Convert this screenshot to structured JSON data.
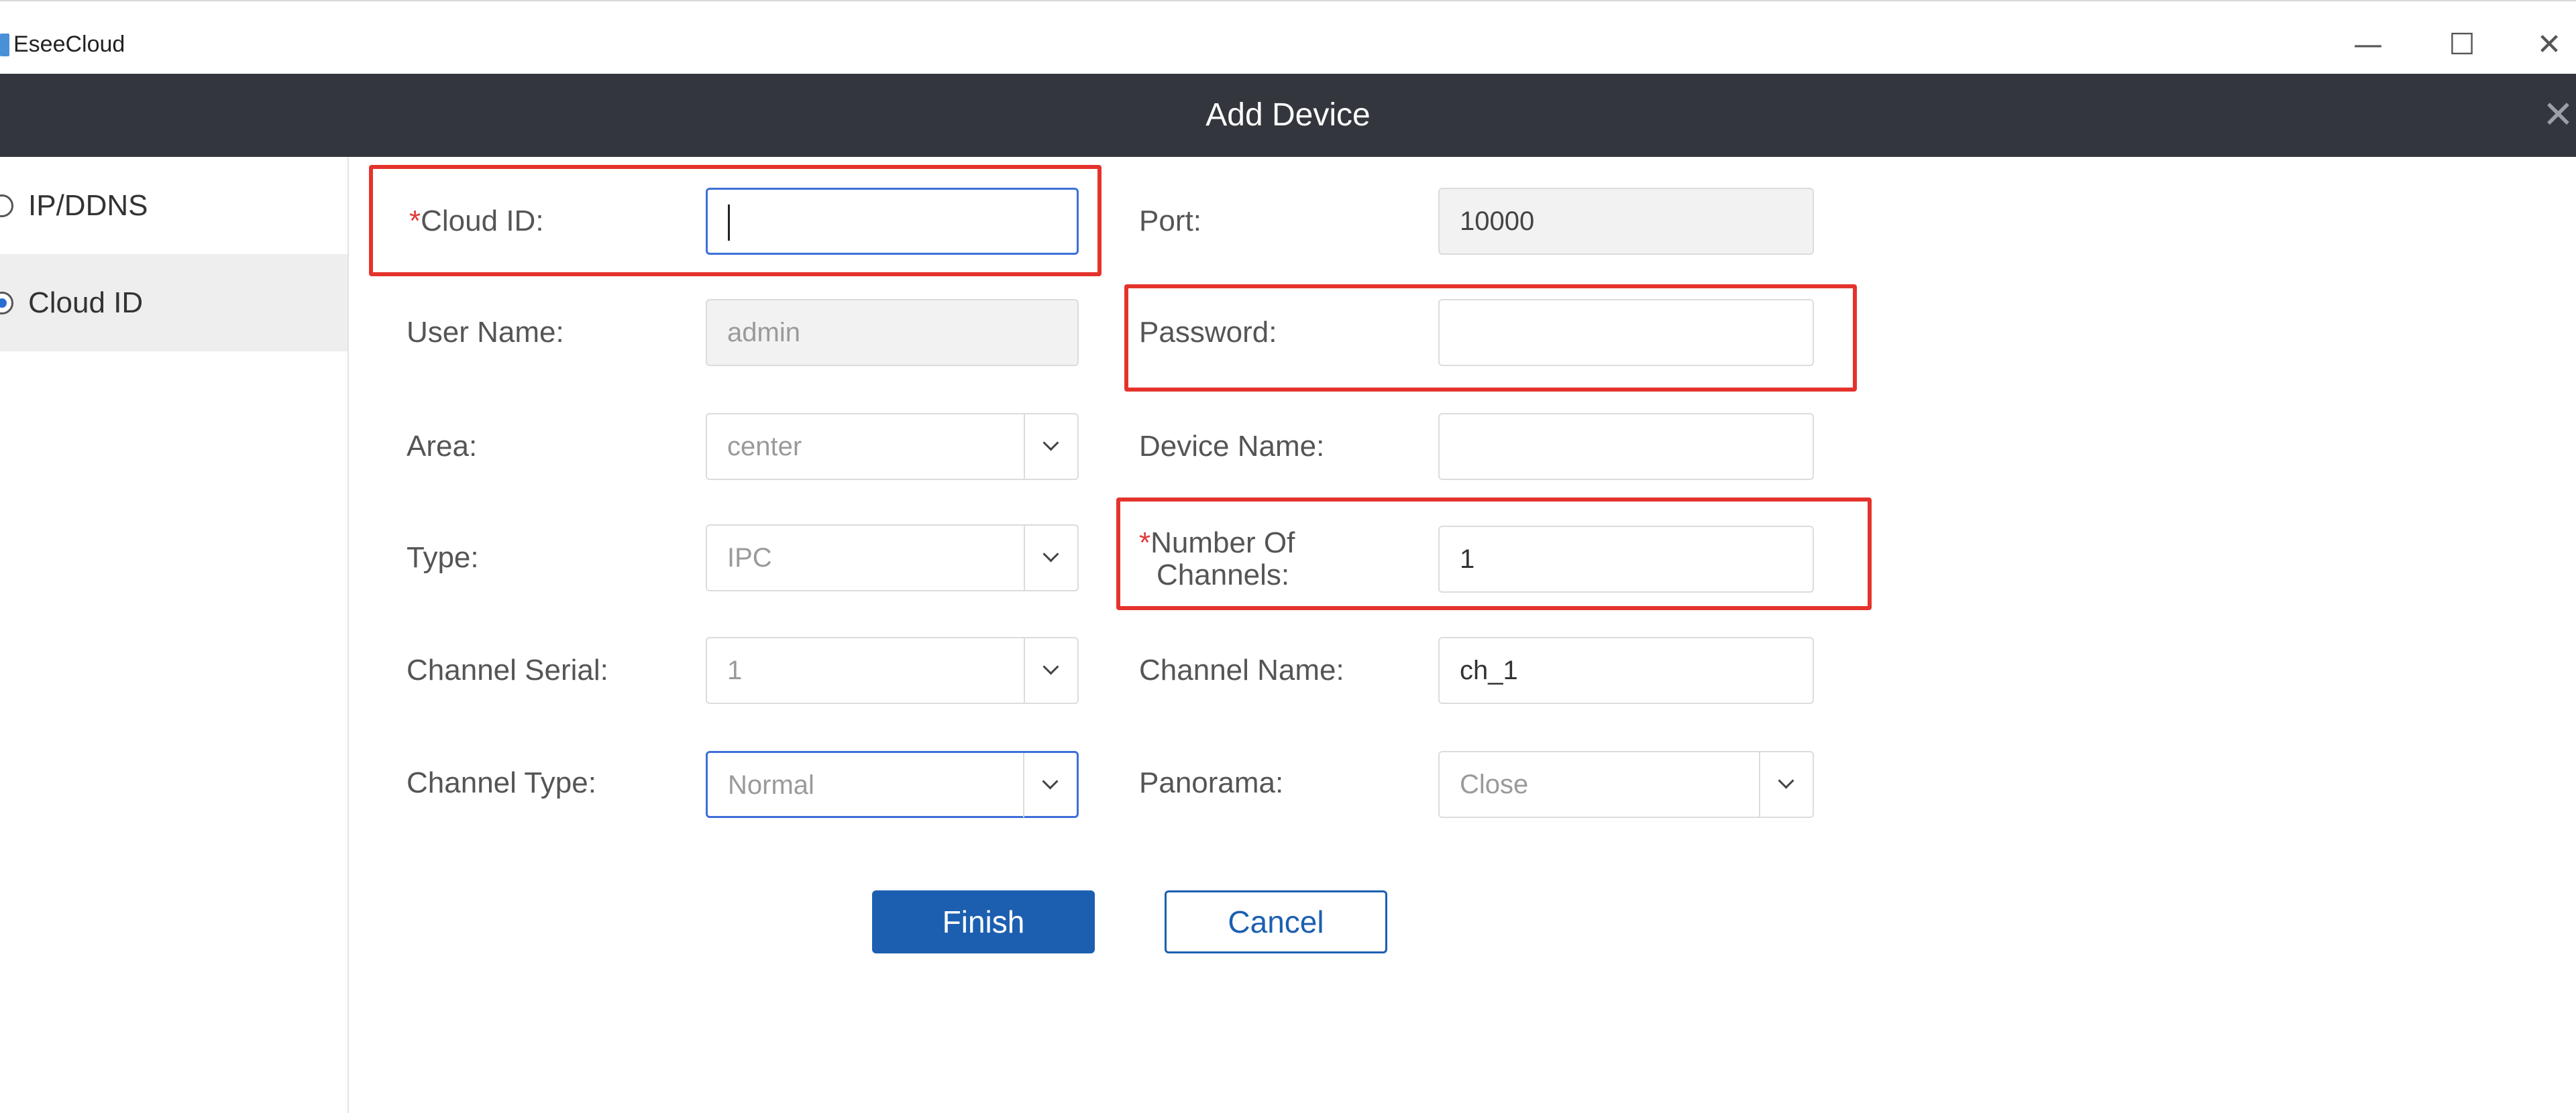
{
  "window": {
    "app_title": "EseeCloud",
    "minimize": "—",
    "maximize": "☐",
    "close": "✕"
  },
  "dialog": {
    "title": "Add Device",
    "close": "✕"
  },
  "sidebar": {
    "items": [
      {
        "label": "IP/DDNS",
        "checked": false
      },
      {
        "label": "Cloud ID",
        "checked": true
      }
    ]
  },
  "form": {
    "required_mark": "*",
    "cloud_id": {
      "label": "Cloud ID:",
      "value": ""
    },
    "port": {
      "label": "Port:",
      "value": "10000"
    },
    "user_name": {
      "label": "User Name:",
      "value": "admin"
    },
    "password": {
      "label": "Password:",
      "value": ""
    },
    "area": {
      "label": "Area:",
      "value": "center"
    },
    "device_name": {
      "label": "Device Name:",
      "value": ""
    },
    "type": {
      "label": "Type:",
      "value": "IPC"
    },
    "channels": {
      "label_line1": "Number Of",
      "label_line2": "Channels:",
      "value": "1"
    },
    "channel_serial": {
      "label": "Channel Serial:",
      "value": "1"
    },
    "channel_name": {
      "label": "Channel Name:",
      "value": "ch_1"
    },
    "channel_type": {
      "label": "Channel Type:",
      "value": "Normal"
    },
    "panorama": {
      "label": "Panorama:",
      "value": "Close"
    }
  },
  "buttons": {
    "finish": "Finish",
    "cancel": "Cancel"
  },
  "colors": {
    "header_bg": "#33373d",
    "accent": "#1c5fb0",
    "highlight": "#e4332c",
    "required": "#e03b3b"
  }
}
